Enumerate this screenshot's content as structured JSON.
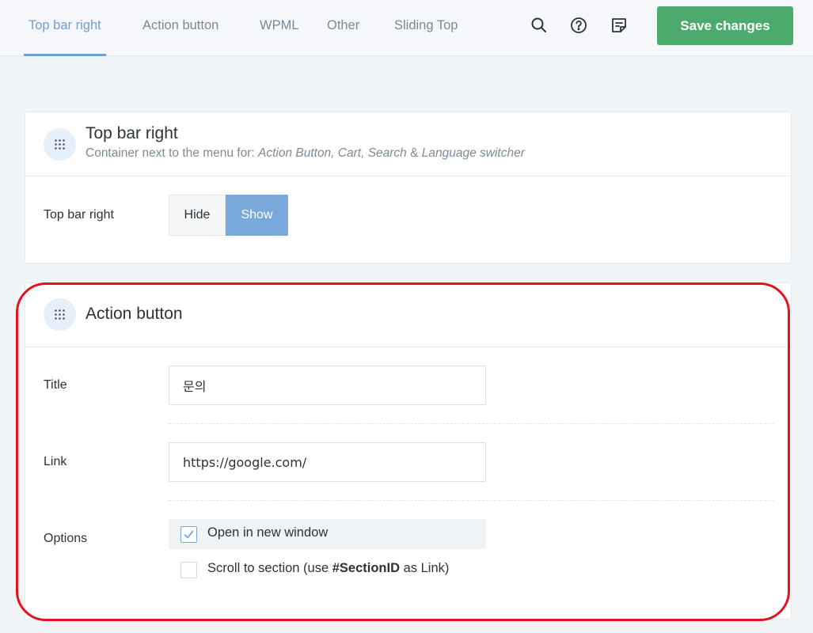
{
  "tabs": [
    {
      "label": "Top bar right",
      "active": true
    },
    {
      "label": "Action button",
      "active": false
    },
    {
      "label": "WPML",
      "active": false
    },
    {
      "label": "Other",
      "active": false
    },
    {
      "label": "Sliding Top",
      "active": false
    }
  ],
  "toolbar": {
    "icons": [
      "search-icon",
      "help-icon",
      "notes-icon"
    ],
    "save_label": "Save changes",
    "save_color": "#4caa6c"
  },
  "top_bar_card": {
    "title": "Top bar right",
    "subtitle_prefix": "Container next to the menu for: ",
    "subtitle_items": "Action Button, Cart, Search",
    "subtitle_amp": " & ",
    "subtitle_last": "Language switcher",
    "row_label": "Top bar right",
    "options": [
      "Hide",
      "Show"
    ],
    "selected": "Show",
    "accent": "#79a8db"
  },
  "action_button_card": {
    "title": "Action button",
    "title_label": "Title",
    "title_value": "문의",
    "link_label": "Link",
    "link_value": "https://google.com/",
    "options_label": "Options",
    "option_new_window": {
      "label": "Open in new window",
      "checked": true
    },
    "option_scroll": {
      "label_prefix": "Scroll to section (use ",
      "label_bold": "#SectionID",
      "label_suffix": " as Link)",
      "checked": false
    },
    "highlight_color": "#e0161e"
  }
}
